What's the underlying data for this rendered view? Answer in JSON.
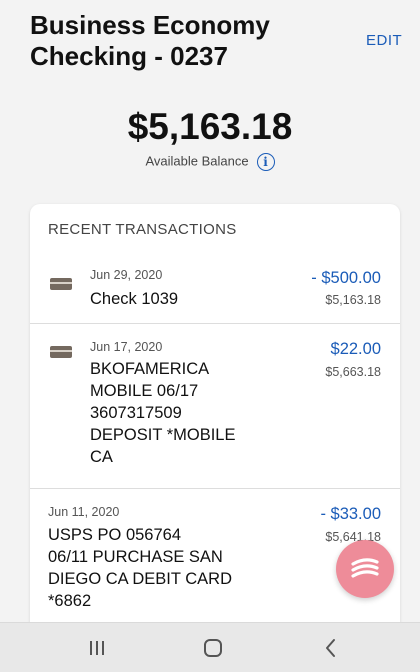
{
  "header": {
    "account_title": "Business Economy Checking - 0237",
    "edit_label": "EDIT"
  },
  "balance": {
    "amount": "$5,163.18",
    "label": "Available Balance"
  },
  "transactions_card": {
    "heading": "RECENT TRANSACTIONS",
    "items": [
      {
        "date": "Jun 29, 2020",
        "description": "Check 1039",
        "amount": "- $500.00",
        "balance": "$5,163.18",
        "icon": "check-icon"
      },
      {
        "date": "Jun 17, 2020",
        "description_lines": [
          "BKOFAMERICA",
          "MOBILE 06/17",
          "3607317509",
          "DEPOSIT *MOBILE",
          "CA"
        ],
        "amount": "$22.00",
        "balance": "$5,663.18",
        "icon": "check-icon"
      },
      {
        "date": "Jun 11, 2020",
        "description_lines": [
          "USPS PO 056764",
          "06/11 PURCHASE SAN",
          "DIEGO CA DEBIT CARD",
          "*6862"
        ],
        "amount": "- $33.00",
        "balance": "$5,641.18"
      }
    ]
  },
  "colors": {
    "accent": "#1b5cb8",
    "fab": "#ee8c99",
    "background": "#f3f3f3"
  },
  "system_nav": {
    "buttons": [
      "recent-apps-icon",
      "home-icon",
      "back-icon"
    ]
  }
}
